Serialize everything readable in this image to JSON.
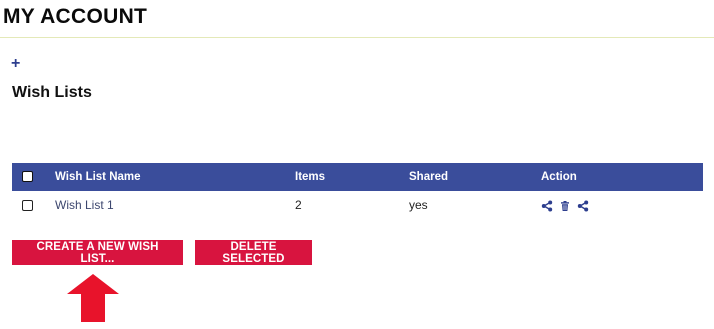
{
  "page": {
    "title": "MY ACCOUNT"
  },
  "section": {
    "title": "Wish Lists",
    "add_icon": "plus-icon"
  },
  "table": {
    "columns": [
      "Wish List Name",
      "Items",
      "Shared",
      "Action"
    ],
    "rows": [
      {
        "name": "Wish List 1",
        "items": "2",
        "shared": "yes",
        "actions": [
          "share-icon",
          "trash-icon",
          "share-icon"
        ]
      }
    ]
  },
  "buttons": {
    "create": "CREATE A NEW WISH LIST...",
    "delete": "DELETE SELECTED"
  },
  "colors": {
    "header_bg": "#3a4d9b",
    "button_bg": "#d8143f",
    "arrow": "#e8132b",
    "accent": "#2d3e8e"
  }
}
